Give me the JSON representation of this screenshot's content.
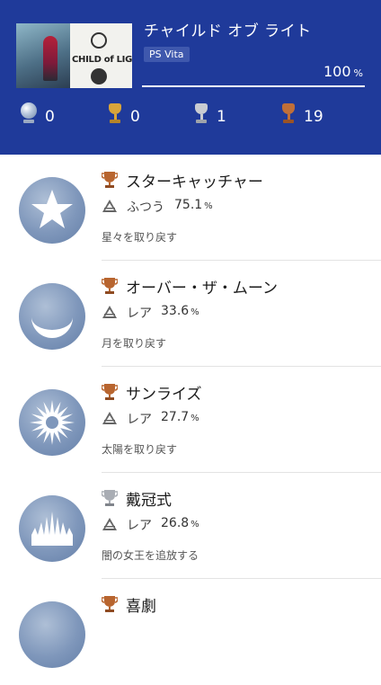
{
  "game": {
    "title": "チャイルド オブ ライト",
    "platform": "PS Vita",
    "progress": 100,
    "progress_label": "100",
    "progress_unit": "%",
    "cover_text": "CHILD of LIGHT"
  },
  "trophy_counts": {
    "platinum": "0",
    "gold": "0",
    "silver": "1",
    "bronze": "19"
  },
  "colors": {
    "header_bg": "#1f3a9a",
    "gold": "#d8a43a",
    "silver": "#b9bcc2",
    "bronze": "#b8652f",
    "badge": "#7f97bb"
  },
  "trophies": [
    {
      "name": "スターキャッチャー",
      "grade": "bronze",
      "rarity_label": "ふつう",
      "rarity_pct": "75.1",
      "unit": "%",
      "description": "星々を取り戻す",
      "icon": "star-icon"
    },
    {
      "name": "オーバー・ザ・ムーン",
      "grade": "bronze",
      "rarity_label": "レア",
      "rarity_pct": "33.6",
      "unit": "%",
      "description": "月を取り戻す",
      "icon": "moon-icon"
    },
    {
      "name": "サンライズ",
      "grade": "bronze",
      "rarity_label": "レア",
      "rarity_pct": "27.7",
      "unit": "%",
      "description": "太陽を取り戻す",
      "icon": "sun-icon"
    },
    {
      "name": "戴冠式",
      "grade": "silver",
      "rarity_label": "レア",
      "rarity_pct": "26.8",
      "unit": "%",
      "description": "闇の女王を追放する",
      "icon": "crown-icon"
    },
    {
      "name": "喜劇",
      "grade": "bronze",
      "rarity_label": "",
      "rarity_pct": "",
      "unit": "",
      "description": "",
      "icon": "mask-icon"
    }
  ]
}
